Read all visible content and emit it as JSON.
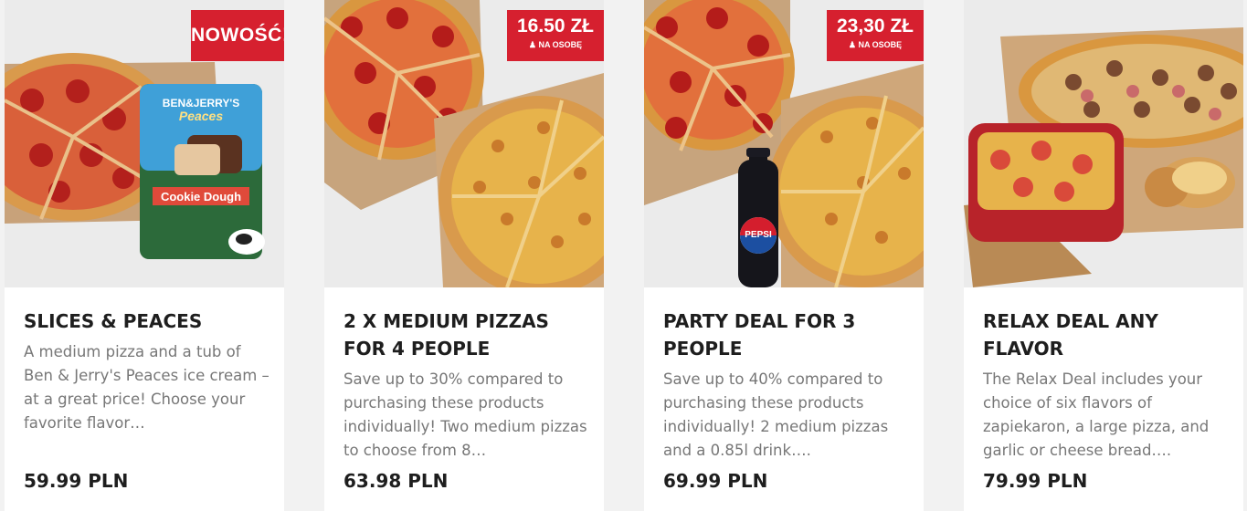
{
  "deals": [
    {
      "title": "SLICES & PEACES",
      "description": "A medium pizza and a tub of Ben & Jerry's Peaces ice cream – at a great price! Choose your favorite flavor…",
      "price": "59.99 PLN",
      "badge": "NOWOŚĆ!",
      "product_name": "BEN&JERRY'S",
      "product_subname": "Peaces",
      "product_flavor": "Cookie Dough"
    },
    {
      "title": "2 X MEDIUM PIZZAS FOR 4 PEOPLE",
      "description": "Save up to 30% compared to purchasing these products individually! Two medium pizzas to choose from 8…",
      "price": "63.98 PLN",
      "badge": "16.50 ZŁ",
      "badge_sub": "NA OSOBĘ"
    },
    {
      "title": "PARTY DEAL FOR 3 PEOPLE",
      "description": "Save up to 40% compared to purchasing these products individually! 2 medium pizzas and a 0.85l drink….",
      "price": "69.99 PLN",
      "badge": "23,30 ZŁ",
      "badge_sub": "NA OSOBĘ",
      "drink_label": "PEPSI"
    },
    {
      "title": "RELAX DEAL ANY FLAVOR",
      "description": "The Relax Deal includes your choice of six flavors of zapiekaron, a large pizza, and garlic or cheese bread….",
      "price": "79.99 PLN"
    }
  ],
  "colors": {
    "badge_red": "#d6202f",
    "title_text": "#1e1e1e",
    "desc_text": "#777777",
    "background": "#f2f2f2"
  },
  "icons": {
    "per_person": "person-icon"
  }
}
